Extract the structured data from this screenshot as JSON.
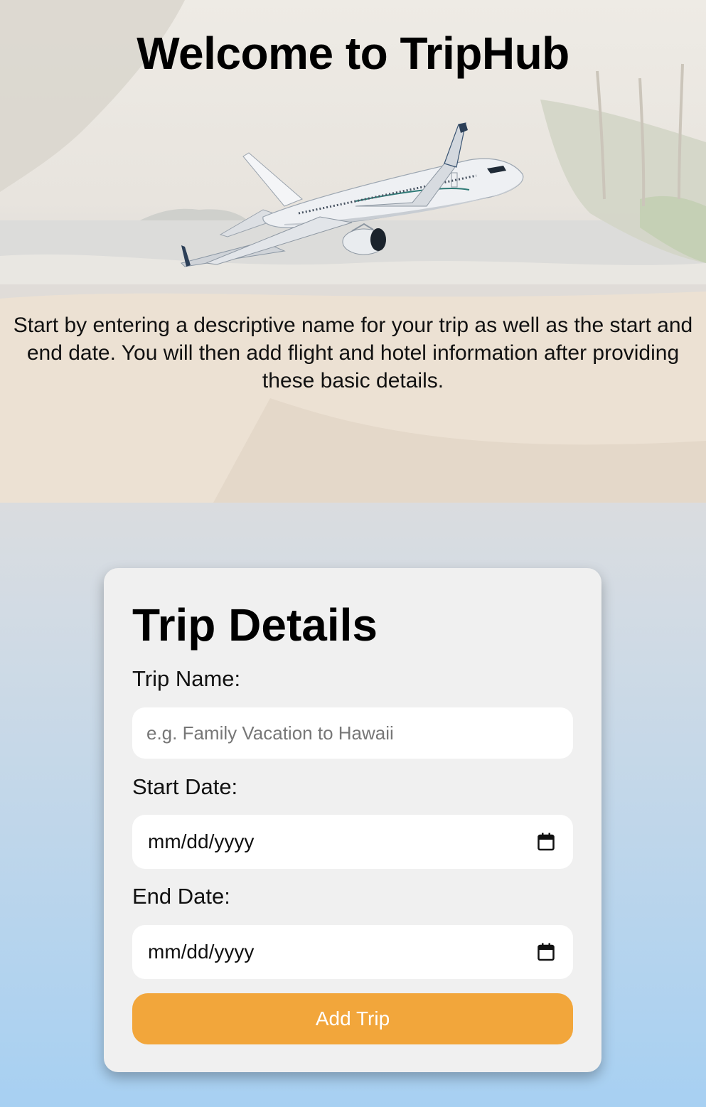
{
  "hero": {
    "title": "Welcome to TripHub",
    "image": "airplane-over-beach",
    "description": "Start by entering a descriptive name for your trip as well as the start and end date. You will then add flight and hotel information after providing these basic details."
  },
  "form": {
    "title": "Trip Details",
    "trip_name": {
      "label": "Trip Name:",
      "placeholder": "e.g. Family Vacation to Hawaii",
      "value": ""
    },
    "start_date": {
      "label": "Start Date:",
      "value": "mm/dd/yyyy",
      "icon": "calendar-icon"
    },
    "end_date": {
      "label": "End Date:",
      "value": "mm/dd/yyyy",
      "icon": "calendar-icon"
    },
    "submit_label": "Add Trip"
  },
  "colors": {
    "button": "#f2a63b",
    "card": "#f0f0f0",
    "page_gradient_bottom": "#a7d0f2"
  }
}
